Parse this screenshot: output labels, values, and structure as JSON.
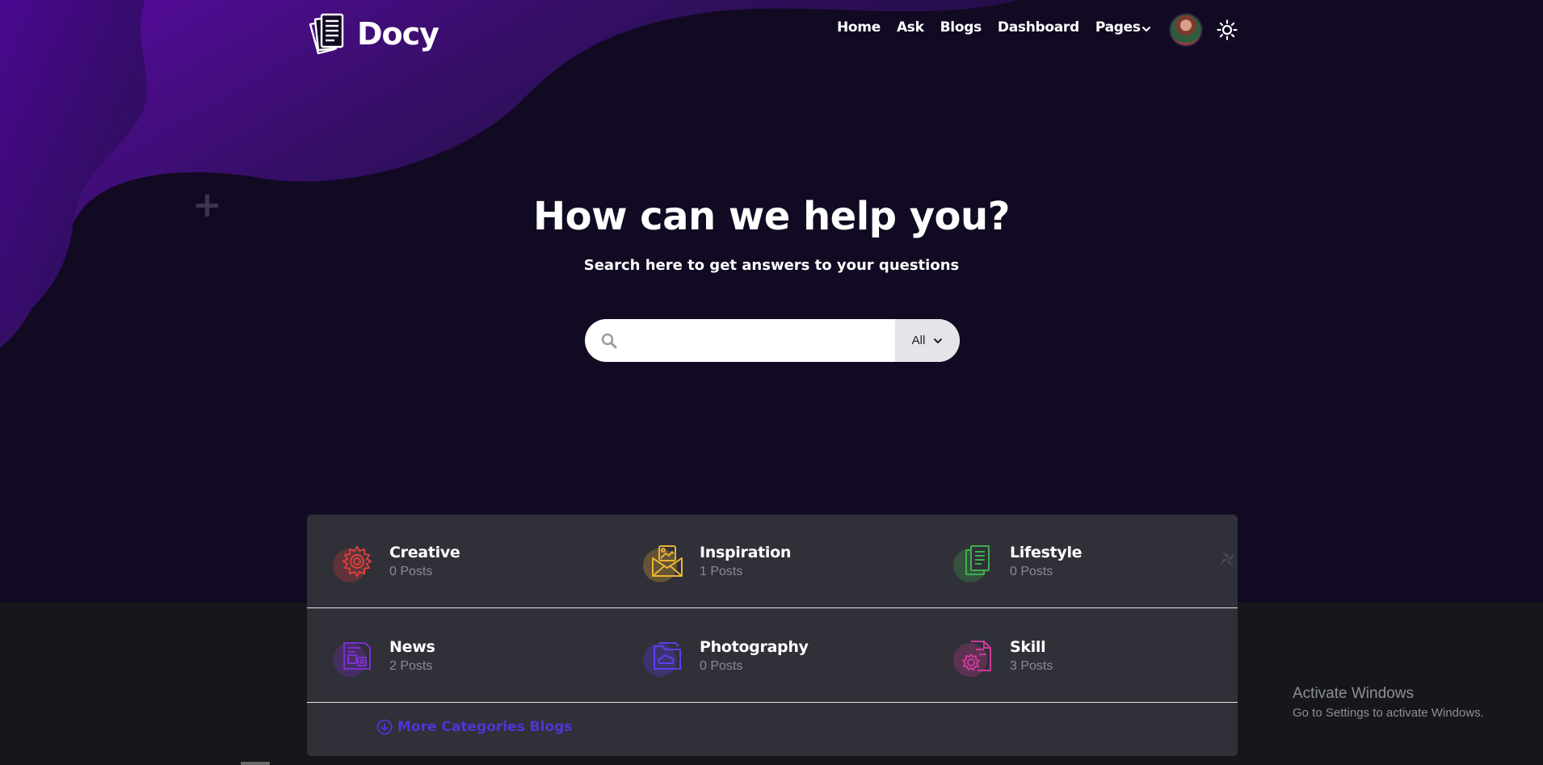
{
  "brand": {
    "name": "Docy"
  },
  "nav": {
    "items": [
      {
        "label": "Home"
      },
      {
        "label": "Ask"
      },
      {
        "label": "Blogs"
      },
      {
        "label": "Dashboard"
      },
      {
        "label": "Pages"
      }
    ]
  },
  "hero": {
    "title": "How can we help you?",
    "subtitle": "Search here to get answers to your questions"
  },
  "search": {
    "placeholder": "",
    "value": "",
    "scope": "All"
  },
  "categories": [
    {
      "name": "Creative",
      "count": "0 Posts",
      "color": "#d7403c"
    },
    {
      "name": "Inspiration",
      "count": "1 Posts",
      "color": "#e9b334"
    },
    {
      "name": "Lifestyle",
      "count": "0 Posts",
      "color": "#3fae4d"
    },
    {
      "name": "News",
      "count": "2 Posts",
      "color": "#7d2fcf"
    },
    {
      "name": "Photography",
      "count": "0 Posts",
      "color": "#5a3ff0"
    },
    {
      "name": "Skill",
      "count": "3 Posts",
      "color": "#d0389a"
    }
  ],
  "more_link": {
    "label": "More Categories Blogs"
  },
  "watermark": {
    "title": "Activate Windows",
    "subtitle": "Go to Settings to activate Windows."
  },
  "colors": {
    "hero_bg": "#110a22",
    "blob_purple": "#4f0a96",
    "accent": "#4f35d6",
    "panel_bg": "#303038",
    "page_bg": "#16171a"
  }
}
